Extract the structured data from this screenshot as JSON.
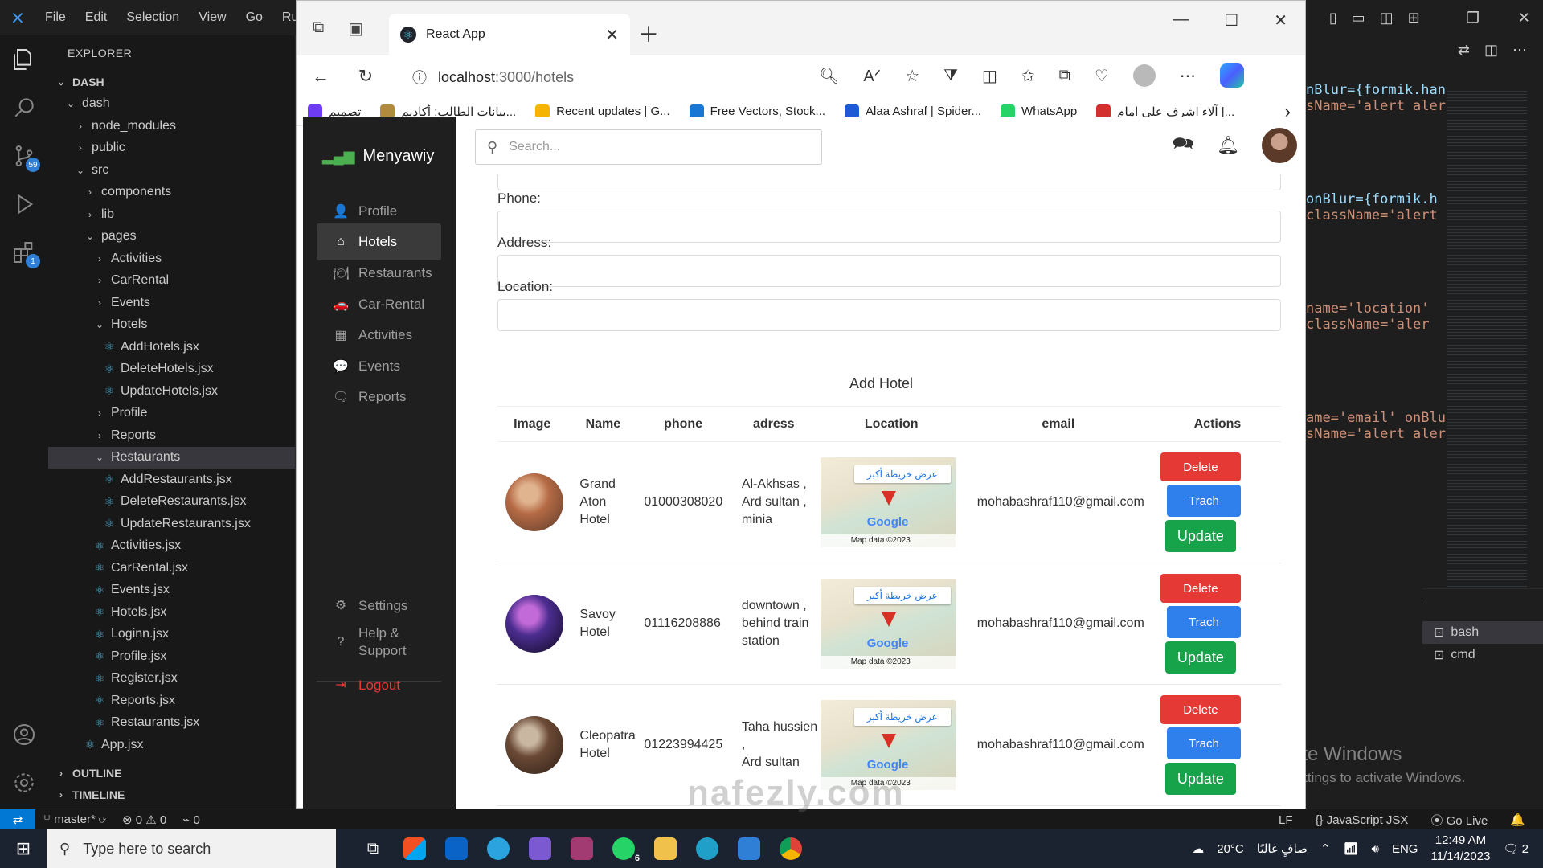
{
  "vscode": {
    "menu": [
      "File",
      "Edit",
      "Selection",
      "View",
      "Go",
      "Run"
    ],
    "explorer_title": "EXPLORER",
    "activity_badges": {
      "source_control": "59",
      "extensions": "1"
    },
    "tree": [
      {
        "label": "DASH",
        "kind": "section",
        "depth": 0,
        "open": true
      },
      {
        "label": "dash",
        "kind": "folder",
        "depth": 1,
        "open": true
      },
      {
        "label": "node_modules",
        "kind": "folder",
        "depth": 2,
        "open": false
      },
      {
        "label": "public",
        "kind": "folder",
        "depth": 2,
        "open": false
      },
      {
        "label": "src",
        "kind": "folder",
        "depth": 2,
        "open": true
      },
      {
        "label": "components",
        "kind": "folder",
        "depth": 3,
        "open": false
      },
      {
        "label": "lib",
        "kind": "folder",
        "depth": 3,
        "open": false
      },
      {
        "label": "pages",
        "kind": "folder",
        "depth": 3,
        "open": true
      },
      {
        "label": "Activities",
        "kind": "folder",
        "depth": 4,
        "open": false
      },
      {
        "label": "CarRental",
        "kind": "folder",
        "depth": 4,
        "open": false
      },
      {
        "label": "Events",
        "kind": "folder",
        "depth": 4,
        "open": false
      },
      {
        "label": "Hotels",
        "kind": "folder",
        "depth": 4,
        "open": true
      },
      {
        "label": "AddHotels.jsx",
        "kind": "file",
        "depth": 5
      },
      {
        "label": "DeleteHotels.jsx",
        "kind": "file",
        "depth": 5
      },
      {
        "label": "UpdateHotels.jsx",
        "kind": "file",
        "depth": 5
      },
      {
        "label": "Profile",
        "kind": "folder",
        "depth": 4,
        "open": false
      },
      {
        "label": "Reports",
        "kind": "folder",
        "depth": 4,
        "open": false
      },
      {
        "label": "Restaurants",
        "kind": "folder",
        "depth": 4,
        "open": true,
        "selected": true
      },
      {
        "label": "AddRestaurants.jsx",
        "kind": "file",
        "depth": 5
      },
      {
        "label": "DeleteRestaurants.jsx",
        "kind": "file",
        "depth": 5
      },
      {
        "label": "UpdateRestaurants.jsx",
        "kind": "file",
        "depth": 5
      },
      {
        "label": "Activities.jsx",
        "kind": "file",
        "depth": 4
      },
      {
        "label": "CarRental.jsx",
        "kind": "file",
        "depth": 4
      },
      {
        "label": "Events.jsx",
        "kind": "file",
        "depth": 4
      },
      {
        "label": "Hotels.jsx",
        "kind": "file",
        "depth": 4
      },
      {
        "label": "Loginn.jsx",
        "kind": "file",
        "depth": 4
      },
      {
        "label": "Profile.jsx",
        "kind": "file",
        "depth": 4
      },
      {
        "label": "Register.jsx",
        "kind": "file",
        "depth": 4
      },
      {
        "label": "Reports.jsx",
        "kind": "file",
        "depth": 4
      },
      {
        "label": "Restaurants.jsx",
        "kind": "file",
        "depth": 4
      },
      {
        "label": "App.jsx",
        "kind": "file",
        "depth": 3
      }
    ],
    "outline_label": "OUTLINE",
    "timeline_label": "TIMELINE",
    "code_fragments": [
      {
        "text": "nBlur={formik.han",
        "cls": "c-blue"
      },
      {
        "text": "sName='alert aler",
        "cls": "c-str"
      },
      {
        "text": "onBlur={formik.h",
        "cls": "c-blue"
      },
      {
        "text": "className='alert",
        "cls": "c-str"
      },
      {
        "text": " name='location'",
        "cls": "c-str"
      },
      {
        "text": " className='aler",
        "cls": "c-str"
      },
      {
        "text": "ame='email' onBlu",
        "cls": "c-str"
      },
      {
        "text": "sName='alert aler",
        "cls": "c-str"
      }
    ],
    "terminals": [
      "bash",
      "cmd"
    ],
    "activate_title": "Activate Windows",
    "activate_sub": "Go to Settings to activate Windows.",
    "status": {
      "branch": "master*",
      "errors": "0",
      "warnings": "0",
      "ports": "0",
      "eol": "LF",
      "language": "JavaScript JSX",
      "golive": "Go Live"
    }
  },
  "browser": {
    "tab_title": "React App",
    "url_host": "localhost",
    "url_path": ":3000/hotels",
    "bookmarks": [
      {
        "label": "تصميم",
        "color": "#6f3cf6"
      },
      {
        "label": "بيانات الطالب: أكاديم...",
        "color": "#b08a3e"
      },
      {
        "label": "Recent updates | G...",
        "color": "#f4b400"
      },
      {
        "label": "Free Vectors, Stock...",
        "color": "#1976d2"
      },
      {
        "label": "Alaa Ashraf | Spider...",
        "color": "#1e5ad6"
      },
      {
        "label": "WhatsApp",
        "color": "#25d366"
      },
      {
        "label": "آلاء اشرف على امام |...",
        "color": "#d32f2f"
      }
    ]
  },
  "app": {
    "brand": "Menyawiy",
    "nav": [
      {
        "label": "Profile",
        "icon": "👤"
      },
      {
        "label": "Hotels",
        "icon": "⌂",
        "active": true
      },
      {
        "label": "Restaurants",
        "icon": "🍽"
      },
      {
        "label": "Car-Rental",
        "icon": "🚗"
      },
      {
        "label": "Activities",
        "icon": "▦"
      },
      {
        "label": "Events",
        "icon": "💬"
      },
      {
        "label": "Reports",
        "icon": "🗨"
      }
    ],
    "bottom_nav": [
      {
        "label": "Settings",
        "icon": "⚙"
      },
      {
        "label": "Help &\nSupport",
        "icon": "?"
      },
      {
        "label": "Logout",
        "icon": "⇥"
      }
    ],
    "search_placeholder": "Search...",
    "form": {
      "phone_label": "Phone:",
      "address_label": "Address:",
      "location_label": "Location:",
      "submit_label": "Add Hotel"
    },
    "table": {
      "headers": [
        "Image",
        "Name",
        "phone",
        "adress",
        "Location",
        "email",
        "Actions"
      ],
      "rows": [
        {
          "name": "Grand\nAton\nHotel",
          "phone": "01000308020",
          "address": "Al-Akhsas ,\nArd sultan ,\nminia",
          "email": "mohabashraf110@gmail.com",
          "img_colors": [
            "#b56a45",
            "#e0b48f",
            "#5a3b2a"
          ]
        },
        {
          "name": "Savoy\nHotel",
          "phone": "01116208886",
          "address": "downtown ,\nbehind train\nstation",
          "email": "mohabashraf110@gmail.com",
          "img_colors": [
            "#4b2d8f",
            "#c26ad8",
            "#10091f"
          ]
        },
        {
          "name": "Cleopatra\nHotel",
          "phone": "01223994425",
          "address": "Taha hussien ,\nArd sultan",
          "email": "mohabashraf110@gmail.com",
          "img_colors": [
            "#6b4a36",
            "#c9b7a2",
            "#2c1d14"
          ]
        }
      ],
      "map": {
        "button": "عرض خريطة أكبر",
        "google": "Google",
        "attribution": "Map data ©2023"
      },
      "actions": {
        "delete": "Delete",
        "track": "Trach",
        "update": "Update"
      }
    }
  },
  "taskbar": {
    "search_placeholder": "Type here to search",
    "weather": "20°C",
    "weather_text": "صافٍ غالبًا",
    "language": "ENG",
    "time": "12:49 AM",
    "date": "11/14/2023",
    "whatsapp_badge": "6",
    "notifications": "2"
  },
  "watermark": "nafezly.com"
}
